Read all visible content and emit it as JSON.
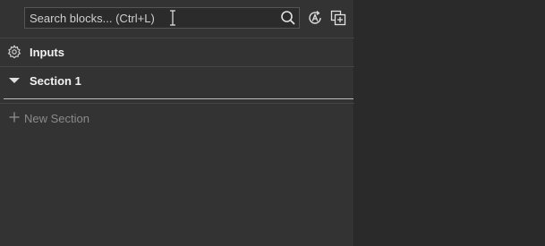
{
  "search": {
    "placeholder": "Search blocks... (Ctrl+L)"
  },
  "toolbar": {
    "search_icon": "search-icon",
    "auto_icon": "auto-layout-icon",
    "duplicate_icon": "duplicate-icon"
  },
  "sections": [
    {
      "label": "Inputs",
      "icon": "gear-icon"
    },
    {
      "label": "Section 1",
      "icon": "triangle-down-icon"
    }
  ],
  "new_section": {
    "label": "New Section",
    "icon": "plus-icon"
  },
  "colors": {
    "panel_bg": "#333333",
    "right_bg": "#2a2a2a",
    "text": "#f2f2f2",
    "muted": "#8a8a8a"
  }
}
